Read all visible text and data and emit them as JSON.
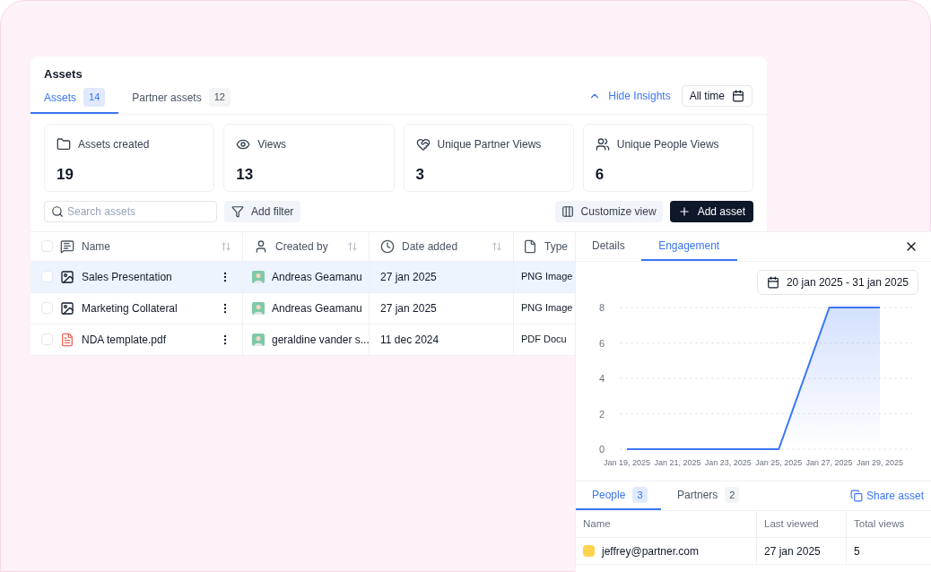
{
  "card": {
    "title": "Assets",
    "tabs": [
      {
        "label": "Assets",
        "count": "14",
        "selected": true
      },
      {
        "label": "Partner assets",
        "count": "12",
        "selected": false
      }
    ],
    "hide_insights": "Hide Insights",
    "period": "All time",
    "stats": [
      {
        "kind": "folder",
        "label": "Assets created",
        "value": "19"
      },
      {
        "kind": "eye",
        "label": "Views",
        "value": "13"
      },
      {
        "kind": "heart",
        "label": "Unique Partner Views",
        "value": "3"
      },
      {
        "kind": "people",
        "label": "Unique People Views",
        "value": "6"
      }
    ],
    "search": {
      "placeholder": "Search assets"
    },
    "add_filter": "Add filter",
    "customize_view": "Customize view",
    "add_asset": "Add asset",
    "table": {
      "all_checked": false,
      "columns": [
        {
          "kind": "name",
          "label": "Name",
          "sortable": true
        },
        {
          "kind": "person",
          "label": "Created by",
          "sortable": true
        },
        {
          "kind": "clock",
          "label": "Date added",
          "sortable": true
        },
        {
          "kind": "file",
          "label": "Type"
        }
      ],
      "rows": [
        {
          "kind": "image",
          "name": "Sales Presentation",
          "created_by": "Andreas Geamanu",
          "date": "27 jan 2025",
          "type": "PNG Image",
          "checked": false,
          "selected": true
        },
        {
          "kind": "image",
          "name": "Marketing Collateral",
          "created_by": "Andreas Geamanu",
          "date": "27 jan 2025",
          "type": "PNG Image",
          "checked": false,
          "selected": false
        },
        {
          "kind": "pdf",
          "name": "NDA template.pdf",
          "created_by": "geraldine vander s...",
          "date": "11 dec 2024",
          "type": "PDF Docu",
          "checked": false,
          "selected": false
        }
      ]
    }
  },
  "panel": {
    "tabs": [
      {
        "label": "Details",
        "selected": false
      },
      {
        "label": "Engagement",
        "selected": true
      }
    ],
    "date_range": "20 jan 2025 - 31 jan 2025",
    "chart_data": {
      "type": "area",
      "grid": true,
      "categories": [
        "Jan 19, 2025",
        "Jan 21, 2025",
        "Jan 23, 2025",
        "Jan 25, 2025",
        "Jan 27, 2025",
        "Jan 29, 2025"
      ],
      "series": [
        {
          "color": "#3b76f6",
          "values": [
            0,
            0,
            0,
            0,
            8,
            8
          ]
        }
      ],
      "ylim": [
        0,
        8
      ],
      "yticks": [
        0,
        2,
        4,
        6,
        8
      ]
    },
    "sub_tabs": [
      {
        "label": "People",
        "count": "3",
        "selected": true
      },
      {
        "label": "Partners",
        "count": "2",
        "selected": false
      }
    ],
    "share": "Share asset",
    "table": {
      "columns": [
        "Name",
        "Last viewed",
        "Total views"
      ],
      "rows": [
        {
          "name": "jeffrey@partner.com",
          "color": "#fcd34d",
          "last_viewed": "27 jan 2025",
          "total_views": "5"
        }
      ]
    }
  }
}
